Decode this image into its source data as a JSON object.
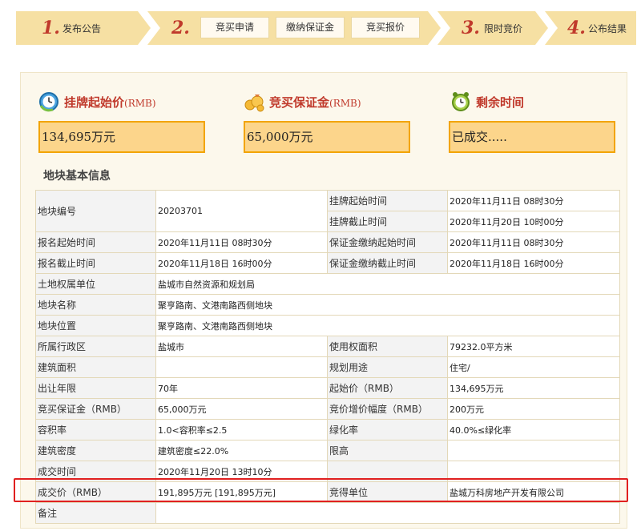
{
  "steps": [
    {
      "num": "1.",
      "label": "发布公告"
    },
    {
      "num": "2.",
      "sub": [
        "竞买申请",
        "缴纳保证金",
        "竞买报价"
      ]
    },
    {
      "num": "3.",
      "label": "限时竞价"
    },
    {
      "num": "4.",
      "label": "公布结果"
    }
  ],
  "summary": {
    "start_price": {
      "title": "挂牌起始价",
      "unit": "(RMB)",
      "value": "134,695万元",
      "icon": "clock-icon"
    },
    "deposit": {
      "title": "竞买保证金",
      "unit": "(RMB)",
      "value": "65,000万元",
      "icon": "money-bag-icon"
    },
    "remaining": {
      "title": "剩余时间",
      "value": "已成交.....",
      "icon": "alarm-clock-icon"
    }
  },
  "section_title": "地块基本信息",
  "table": {
    "parcel_no": {
      "label": "地块编号",
      "value": "20203701"
    },
    "list_start": {
      "label": "挂牌起始时间",
      "value": "2020年11月11日 08时30分"
    },
    "list_end": {
      "label": "挂牌截止时间",
      "value": "2020年11月20日 10时00分"
    },
    "reg_start": {
      "label": "报名起始时间",
      "value": "2020年11月11日 08时30分"
    },
    "dep_start": {
      "label": "保证金缴纳起始时间",
      "value": "2020年11月11日 08时30分"
    },
    "reg_end": {
      "label": "报名截止时间",
      "value": "2020年11月18日 16时00分"
    },
    "dep_end": {
      "label": "保证金缴纳截止时间",
      "value": "2020年11月18日 16时00分"
    },
    "owner": {
      "label": "土地权属单位",
      "value": "盐城市自然资源和规划局"
    },
    "name": {
      "label": "地块名称",
      "value": "聚亨路南、文港南路西侧地块"
    },
    "location": {
      "label": "地块位置",
      "value": "聚亨路南、文港南路西侧地块"
    },
    "district": {
      "label": "所属行政区",
      "value": "盐城市"
    },
    "use_area": {
      "label": "使用权面积",
      "value": "79232.0平方米"
    },
    "build_area": {
      "label": "建筑面积",
      "value": ""
    },
    "plan_use": {
      "label": "规划用途",
      "value": "住宅/"
    },
    "years": {
      "label": "出让年限",
      "value": "70年"
    },
    "start_price": {
      "label": "起始价（RMB）",
      "value": "134,695万元"
    },
    "deposit": {
      "label": "竞买保证金（RMB）",
      "value": "65,000万元"
    },
    "increment": {
      "label": "竞价增价幅度（RMB）",
      "value": "200万元"
    },
    "far": {
      "label": "容积率",
      "value": "1.0<容积率≤2.5"
    },
    "green": {
      "label": "绿化率",
      "value": "40.0%≤绿化率"
    },
    "density": {
      "label": "建筑密度",
      "value": "建筑密度≤22.0%"
    },
    "height": {
      "label": "限高",
      "value": ""
    },
    "deal_time": {
      "label": "成交时间",
      "value": "2020年11月20日 13时10分"
    },
    "deal_price": {
      "label": "成交价（RMB）",
      "value": "191,895万元 [191,895万元]"
    },
    "winner": {
      "label": "竞得单位",
      "value": "盐城万科房地产开发有限公司"
    },
    "remark": {
      "label": "备注",
      "value": ""
    }
  }
}
